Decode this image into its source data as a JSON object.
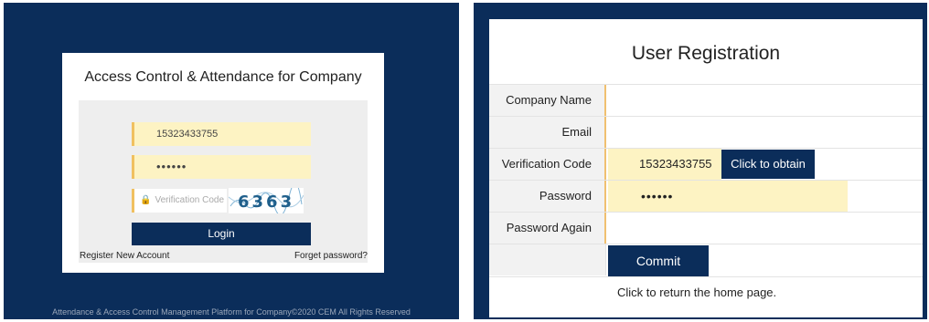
{
  "login": {
    "title": "Access Control & Attendance for Company",
    "phone_value": "15323433755",
    "password_value": "••••••",
    "verification_placeholder": "Verification Code",
    "captcha_text": "6363",
    "login_label": "Login",
    "register_label": "Register New Account",
    "forget_label": "Forget password?",
    "footer": "Attendance & Access Control Management Platform for Company©2020 CEM All Rights Reserved"
  },
  "registration": {
    "title": "User Registration",
    "fields": [
      {
        "label": "Company Name",
        "value": ""
      },
      {
        "label": "Email",
        "value": ""
      },
      {
        "label": "Verification Code",
        "value": "15323433755"
      },
      {
        "label": "Password",
        "value": "••••••"
      },
      {
        "label": "Password Again",
        "value": ""
      }
    ],
    "obtain_label": "Click to obtain",
    "commit_label": "Commit",
    "return_label": "Click to return the home page."
  },
  "colors": {
    "navy": "#0b2d5a",
    "input_yellow": "#fdf3c3",
    "accent_border": "#f0c060"
  }
}
